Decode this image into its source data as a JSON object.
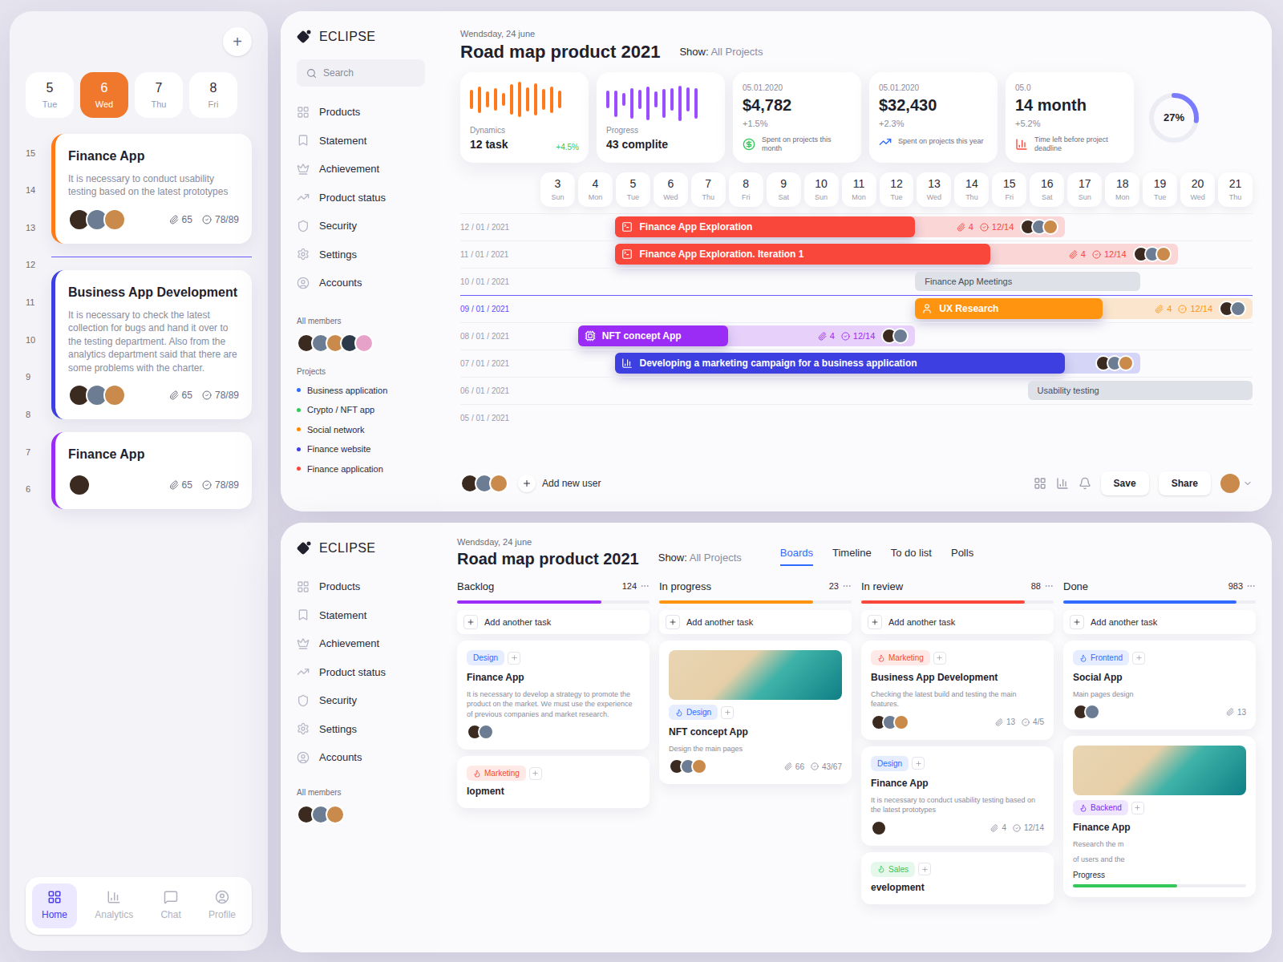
{
  "main": {
    "logo": "ECLIPSE",
    "search": {
      "placeholder": "Search"
    },
    "nav": [
      "Products",
      "Statement",
      "Achievement",
      "Product status",
      "Security",
      "Settings",
      "Accounts"
    ],
    "members_label": "All members",
    "members": 5,
    "projects_label": "Projects",
    "projects": [
      {
        "name": "Business application",
        "color": "#2f6bff"
      },
      {
        "name": "Crypto / NFT app",
        "color": "#34c759"
      },
      {
        "name": "Social network",
        "color": "#ff8a00"
      },
      {
        "name": "Finance website",
        "color": "#3d3fe0"
      },
      {
        "name": "Finance application",
        "color": "#f9473b"
      }
    ],
    "date": "Wendsday, 24 june",
    "title": "Road map product 2021",
    "show_label": "Show:",
    "show_value": "All Projects",
    "chart_cards": [
      {
        "label": "Dynamics",
        "value": "12 task",
        "delta": "+4.5%",
        "color": "#ff7a1a",
        "values": [
          22,
          30,
          18,
          26,
          14,
          34,
          40,
          28,
          36,
          24,
          30,
          20
        ]
      },
      {
        "label": "Progress",
        "value": "43 complite",
        "delta": "",
        "color": "#9b4dff",
        "values": [
          16,
          24,
          12,
          28,
          18,
          30,
          14,
          26,
          20,
          32,
          22,
          28
        ]
      }
    ],
    "money_cards": [
      {
        "date": "05.01.2020",
        "amount": "$4,782",
        "delta": "+1.5%",
        "note": "Spent on projects this month",
        "color": "#34c759"
      },
      {
        "date": "05.01.2020",
        "amount": "$32,430",
        "delta": "+2.3%",
        "note": "Spent on projects this year",
        "color": "#2f6bff"
      },
      {
        "date": "05.0",
        "amount": "14 month",
        "delta": "+5.2%",
        "note": "Time left before project deadline",
        "color": "#f9473b"
      }
    ],
    "ring": {
      "reading": "27%",
      "level": 0.27
    },
    "days": [
      {
        "num": "3",
        "day": "Sun"
      },
      {
        "num": "4",
        "day": "Mon"
      },
      {
        "num": "5",
        "day": "Tue"
      },
      {
        "num": "6",
        "day": "Wed"
      },
      {
        "num": "7",
        "day": "Thu"
      },
      {
        "num": "8",
        "day": "Fri"
      },
      {
        "num": "9",
        "day": "Sat"
      },
      {
        "num": "10",
        "day": "Sun"
      },
      {
        "num": "11",
        "day": "Mon"
      },
      {
        "num": "12",
        "day": "Tue"
      },
      {
        "num": "13",
        "day": "Wed"
      },
      {
        "num": "14",
        "day": "Thu"
      },
      {
        "num": "15",
        "day": "Fri"
      },
      {
        "num": "16",
        "day": "Sat"
      },
      {
        "num": "17",
        "day": "Sun"
      },
      {
        "num": "18",
        "day": "Mon"
      },
      {
        "num": "19",
        "day": "Tue"
      },
      {
        "num": "20",
        "day": "Wed"
      },
      {
        "num": "21",
        "day": "Thu"
      }
    ],
    "rows": [
      {
        "date": "12 / 01 / 2021",
        "selected": false
      },
      {
        "date": "11 / 01 / 2021",
        "selected": false
      },
      {
        "date": "10 / 01 / 2021",
        "selected": false
      },
      {
        "date": "09 / 01 / 2021",
        "selected": true
      },
      {
        "date": "08 / 01 / 2021",
        "selected": false
      },
      {
        "date": "07 / 01 / 2021",
        "selected": false
      },
      {
        "date": "06 / 01 / 2021",
        "selected": false
      },
      {
        "date": "05 / 01 / 2021",
        "selected": false
      }
    ],
    "bars": [
      {
        "label": "Finance App Exploration",
        "kind": "task",
        "row": 0,
        "start": 5,
        "end": 12,
        "extend": 16,
        "color": "#f9473b",
        "attachments": "4",
        "checks": "12/14",
        "avatars": 3
      },
      {
        "label": "Finance App Exploration. Iteration 1",
        "kind": "task",
        "row": 1,
        "start": 5,
        "end": 14,
        "extend": 19,
        "color": "#f9473b",
        "attachments": "4",
        "checks": "12/14",
        "avatars": 3
      },
      {
        "label": "Finance App Meetings",
        "kind": "plain",
        "row": 2,
        "start": 13,
        "end": 18,
        "extend": 18,
        "color": "#c9ccd6",
        "attachments": "",
        "checks": "",
        "avatars": 0
      },
      {
        "label": "UX Research",
        "kind": "task",
        "row": 3,
        "start": 13,
        "end": 17,
        "extend": 21,
        "color": "#ff9410",
        "attachments": "4",
        "checks": "12/14",
        "avatars": 2
      },
      {
        "label": "NFT concept App",
        "kind": "task",
        "row": 4,
        "start": 4,
        "end": 7,
        "extend": 12,
        "color": "#9b2cf5",
        "attachments": "4",
        "checks": "12/14",
        "avatars": 2
      },
      {
        "label": "Developing a marketing campaign for a business application",
        "kind": "task",
        "row": 5,
        "start": 5,
        "end": 16,
        "extend": 18,
        "color": "#3d3fe0",
        "attachments": "",
        "checks": "",
        "avatars": 3
      },
      {
        "label": "Usability testing",
        "kind": "plain",
        "row": 6,
        "start": 16,
        "end": 21,
        "extend": 21,
        "color": "#c9ccd6",
        "attachments": "",
        "checks": "",
        "avatars": 0
      }
    ],
    "toolbar": {
      "avatars": 3,
      "add_user": "Add new user",
      "save": "Save",
      "share": "Share"
    }
  },
  "mobile": {
    "add": "+",
    "days": [
      {
        "num": "5",
        "day": "Tue",
        "selected": false
      },
      {
        "num": "6",
        "day": "Wed",
        "selected": true
      },
      {
        "num": "7",
        "day": "Thu",
        "selected": false
      },
      {
        "num": "8",
        "day": "Fri",
        "selected": false
      }
    ],
    "hours": [
      "15",
      "14",
      "13",
      "12",
      "11",
      "10",
      "9",
      "8",
      "7",
      "6"
    ],
    "cards": [
      {
        "title": "Finance App",
        "text": "It is necessary to conduct usability testing based on the latest prototypes",
        "attachments": "65",
        "checks": "78/89",
        "avatars": 3,
        "color": "#ff7a1a",
        "line_after": true
      },
      {
        "title": "Business App Development",
        "text": "It is necessary to check the latest collection for bugs and hand it over to the testing department. Also from the analytics department said that there are some problems with the charter.",
        "attachments": "65",
        "checks": "78/89",
        "avatars": 3,
        "color": "#3d3fe0",
        "line_after": false
      },
      {
        "title": "Finance App",
        "text": "",
        "attachments": "65",
        "checks": "78/89",
        "avatars": 1,
        "color": "#9b2cf5",
        "line_after": false
      }
    ],
    "tabs": [
      {
        "label": "Home",
        "selected": true
      },
      {
        "label": "Analytics",
        "selected": false
      },
      {
        "label": "Chat",
        "selected": false
      },
      {
        "label": "Profile",
        "selected": false
      }
    ]
  },
  "board": {
    "logo": "ECLIPSE",
    "nav": [
      "Products",
      "Statement",
      "Achievement",
      "Product status",
      "Security",
      "Settings",
      "Accounts"
    ],
    "members_label": "All members",
    "members": 3,
    "date": "Wendsday, 24 june",
    "title": "Road map product 2021",
    "show_label": "Show:",
    "show_value": "All Projects",
    "tabs": [
      {
        "label": "Boards",
        "selected": true
      },
      {
        "label": "Timeline",
        "selected": false
      },
      {
        "label": "To do list",
        "selected": false
      },
      {
        "label": "Polls",
        "selected": false
      }
    ],
    "add_task": "Add another task",
    "columns": [
      {
        "name": "Backlog",
        "count": "124",
        "level": 0.75,
        "color": "#9b2cf5",
        "cards": [
          {
            "kind": "task",
            "tag": "Design",
            "tag_color": "#2f6bff",
            "flame": false,
            "title": "Finance App",
            "text": [
              "It is necessary to develop a strategy to promote the product on the market. We must use the experience of previous companies and market research."
            ],
            "attachments": "",
            "checks": "",
            "avatars": 2
          },
          {
            "kind": "stub",
            "tag": "Marketing",
            "tag_color": "#f9473b",
            "flame": true,
            "title": "lopment",
            "text": [],
            "attachments": "",
            "checks": "",
            "avatars": 0
          }
        ]
      },
      {
        "name": "In progress",
        "count": "23",
        "level": 0.8,
        "color": "#ff9410",
        "cards": [
          {
            "kind": "image",
            "tag": "Design",
            "tag_color": "#2f6bff",
            "flame": true,
            "title": "NFT concept App",
            "text": [
              "Design the main pages"
            ],
            "attachments": "66",
            "checks": "43/67",
            "avatars": 3
          }
        ]
      },
      {
        "name": "In review",
        "count": "88",
        "level": 0.85,
        "color": "#f9473b",
        "cards": [
          {
            "kind": "task",
            "tag": "Marketing",
            "tag_color": "#f9473b",
            "flame": true,
            "title": "Business App Development",
            "text": [
              "Checking the latest build and testing the main features."
            ],
            "attachments": "13",
            "checks": "4/5",
            "avatars": 3
          },
          {
            "kind": "task",
            "tag": "Design",
            "tag_color": "#2f6bff",
            "flame": false,
            "title": "Finance App",
            "text": [
              "It is necessary to conduct usability testing based on the latest prototypes"
            ],
            "attachments": "4",
            "checks": "12/14",
            "avatars": 1
          },
          {
            "kind": "stub",
            "tag": "Sales",
            "tag_color": "#34c759",
            "flame": true,
            "title": "evelopment",
            "text": [],
            "attachments": "",
            "checks": "",
            "avatars": 0
          }
        ]
      },
      {
        "name": "Done",
        "count": "983",
        "level": 0.9,
        "color": "#2f6bff",
        "cards": [
          {
            "kind": "task",
            "tag": "Frontend",
            "tag_color": "#2f6bff",
            "flame": true,
            "title": "Social App",
            "text": [
              "Main pages design"
            ],
            "attachments": "13",
            "checks": "",
            "avatars": 2
          },
          {
            "kind": "image",
            "tag": "Backend",
            "tag_color": "#7b2cf5",
            "flame": true,
            "title": "Finance App",
            "text": [
              "Research the m",
              "of users and the"
            ],
            "attachments": "",
            "checks": "",
            "avatars": 0,
            "progress": {
              "label": "Progress",
              "level": 0.6
            }
          }
        ]
      }
    ]
  }
}
